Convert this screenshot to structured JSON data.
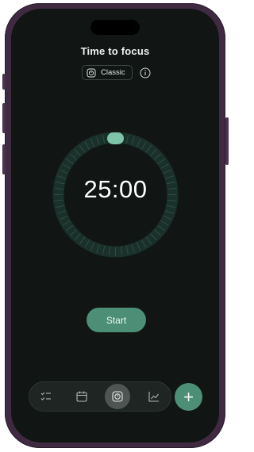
{
  "header": {
    "title": "Time to focus"
  },
  "mode": {
    "label": "Classic",
    "icon": "timer-square-icon",
    "info_icon": "info-circle-icon"
  },
  "timer": {
    "time": "25:00",
    "progress": 0.0,
    "tick_count": 60
  },
  "actions": {
    "start_label": "Start"
  },
  "nav": {
    "items": [
      {
        "name": "tasks",
        "icon": "checklist-icon"
      },
      {
        "name": "calendar",
        "icon": "calendar-icon"
      },
      {
        "name": "focus",
        "icon": "timer-square-icon",
        "active": true
      },
      {
        "name": "stats",
        "icon": "chart-line-icon"
      }
    ],
    "add_label": "+"
  },
  "colors": {
    "background": "#111614",
    "accent": "#4c8f76",
    "ring": "#1a302a",
    "tick": "#2f4d44",
    "knob": "#7fc3a8"
  }
}
